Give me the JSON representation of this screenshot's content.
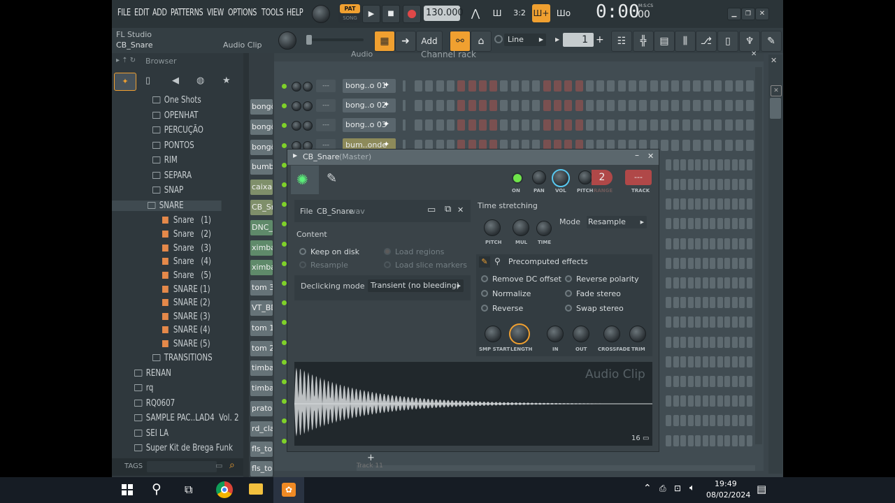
{
  "menu": [
    "FILE",
    "EDIT",
    "ADD",
    "PATTERNS",
    "VIEW",
    "OPTIONS",
    "TOOLS",
    "HELP"
  ],
  "transport": {
    "pat_label": "PAT",
    "song_label": "SONG",
    "tempo": "130.000",
    "time": "0:00",
    "time_small": "00",
    "time_unit": "M:S:CS"
  },
  "hint": {
    "app": "FL Studio",
    "item": "CB_Snare",
    "type": "Audio Clip"
  },
  "toolbar": {
    "add_label": "Add",
    "snap_label": "Line",
    "pattern_num": "1"
  },
  "browser": {
    "title": "Browser",
    "items": [
      {
        "label": "One Shots",
        "type": "folder",
        "indent": 1
      },
      {
        "label": "OPENHAT",
        "type": "folder",
        "indent": 1
      },
      {
        "label": "PERCUÇÃO",
        "type": "folder",
        "indent": 1
      },
      {
        "label": "PONTOS",
        "type": "folder",
        "indent": 1
      },
      {
        "label": "RIM",
        "type": "folder",
        "indent": 1
      },
      {
        "label": "SEPARA",
        "type": "folder",
        "indent": 1
      },
      {
        "label": "SNAP",
        "type": "folder",
        "indent": 1
      },
      {
        "label": "SNARE",
        "type": "folder-open",
        "indent": 1
      },
      {
        "label": "Snare   (1)",
        "type": "file",
        "indent": 2
      },
      {
        "label": "Snare   (2)",
        "type": "file",
        "indent": 2
      },
      {
        "label": "Snare   (3)",
        "type": "file",
        "indent": 2
      },
      {
        "label": "Snare   (4)",
        "type": "file",
        "indent": 2
      },
      {
        "label": "Snare   (5)",
        "type": "file",
        "indent": 2
      },
      {
        "label": "SNARE (1)",
        "type": "file",
        "indent": 2
      },
      {
        "label": "SNARE (2)",
        "type": "file",
        "indent": 2
      },
      {
        "label": "SNARE (3)",
        "type": "file",
        "indent": 2
      },
      {
        "label": "SNARE (4)",
        "type": "file",
        "indent": 2
      },
      {
        "label": "SNARE (5)",
        "type": "file",
        "indent": 2
      },
      {
        "label": "TRANSITIONS",
        "type": "folder",
        "indent": 1
      },
      {
        "label": "RENAN",
        "type": "folder",
        "indent": 0
      },
      {
        "label": "rq",
        "type": "folder",
        "indent": 0
      },
      {
        "label": "RQ0607",
        "type": "folder",
        "indent": 0
      },
      {
        "label": "SAMPLE PAC..LAD4  Vol. 2",
        "type": "folder",
        "indent": 0
      },
      {
        "label": "SEI LA",
        "type": "folder",
        "indent": 0
      },
      {
        "label": "Super Kit de Brega Funk",
        "type": "folder",
        "indent": 0
      }
    ],
    "tags_label": "TAGS"
  },
  "channel_rack": {
    "title": "Channel rack",
    "group": "Audio",
    "channels": [
      "bong..o 01",
      "bong..o 02",
      "bong..o 03",
      "bum..onde"
    ],
    "side_channels": [
      "bongô",
      "bongô",
      "bongô",
      "bumbo",
      "caixa I",
      "CB_Snare",
      "DNC_K",
      "ximba",
      "ximba",
      "tom 3",
      "VT_BD",
      "tom 1",
      "tom 2",
      "timbal",
      "timbal",
      "prato",
      "rd_cla",
      "fls_tor",
      "fls_tomm 04"
    ],
    "bottom_track": "Track 11",
    "dash": "---"
  },
  "plugin": {
    "title": "CB_Snare",
    "title_suffix": "(Master)",
    "top_labels": {
      "on": "ON",
      "pan": "PAN",
      "vol": "VOL",
      "pitch": "PITCH",
      "range": "RANGE",
      "track": "TRACK",
      "range_value": "2",
      "track_value": "---"
    },
    "file_label": "File",
    "file_name": "CB_Snare",
    "file_ext": ".wav",
    "content_label": "Content",
    "content_opts": [
      {
        "label": "Keep on disk",
        "enabled": true
      },
      {
        "label": "Resample",
        "enabled": false
      },
      {
        "label": "Load regions",
        "enabled": false
      },
      {
        "label": "Load slice markers",
        "enabled": false
      }
    ],
    "declicking_label": "Declicking mode",
    "declicking_value": "Transient (no bleeding)",
    "time_stretching_label": "Time stretching",
    "ts_knobs": [
      "PITCH",
      "MUL",
      "TIME"
    ],
    "mode_label": "Mode",
    "mode_value": "Resample",
    "precomputed_label": "Precomputed effects",
    "effects": [
      "Remove DC offset",
      "Reverse polarity",
      "Normalize",
      "Fade stereo",
      "Reverse",
      "Swap stereo"
    ],
    "env_knobs": [
      "SMP START",
      "LENGTH",
      "IN",
      "OUT",
      "CROSSFADE",
      "TRIM"
    ],
    "waveform_label": "Audio Clip",
    "waveform_num": "16"
  },
  "taskbar": {
    "time": "19:49",
    "date": "08/02/2024"
  }
}
